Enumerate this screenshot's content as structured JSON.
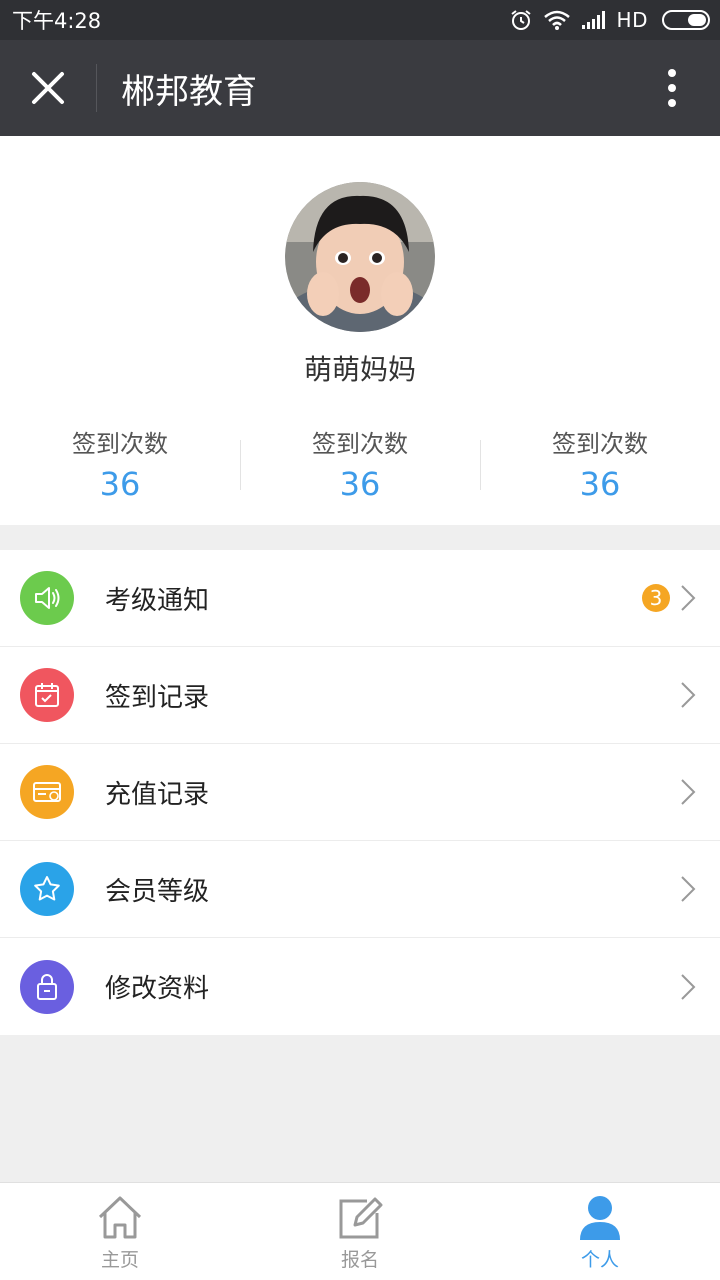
{
  "status_bar": {
    "time": "下午4:28",
    "network": "HD"
  },
  "nav": {
    "title": "郴邦教育",
    "close_icon": "close-icon",
    "more_icon": "more-vertical-icon"
  },
  "profile": {
    "username": "萌萌妈妈",
    "stats": [
      {
        "label": "签到次数",
        "value": "36"
      },
      {
        "label": "签到次数",
        "value": "36"
      },
      {
        "label": "签到次数",
        "value": "36"
      }
    ]
  },
  "menu": [
    {
      "label": "考级通知",
      "icon": "speaker-icon",
      "color": "#6ccb4d",
      "badge": "3"
    },
    {
      "label": "签到记录",
      "icon": "calendar-check-icon",
      "color": "#f0565f",
      "badge": ""
    },
    {
      "label": "充值记录",
      "icon": "card-icon",
      "color": "#f5a623",
      "badge": ""
    },
    {
      "label": "会员等级",
      "icon": "star-icon",
      "color": "#2aa3e8",
      "badge": ""
    },
    {
      "label": "修改资料",
      "icon": "lock-icon",
      "color": "#6a5fe0",
      "badge": ""
    }
  ],
  "tabs": [
    {
      "label": "主页",
      "icon": "home-icon",
      "active": false
    },
    {
      "label": "报名",
      "icon": "edit-icon",
      "active": false
    },
    {
      "label": "个人",
      "icon": "user-icon",
      "active": true
    }
  ],
  "colors": {
    "accent": "#3d9be9",
    "nav_bg": "#3a3b40",
    "status_bg": "#2f3034"
  }
}
